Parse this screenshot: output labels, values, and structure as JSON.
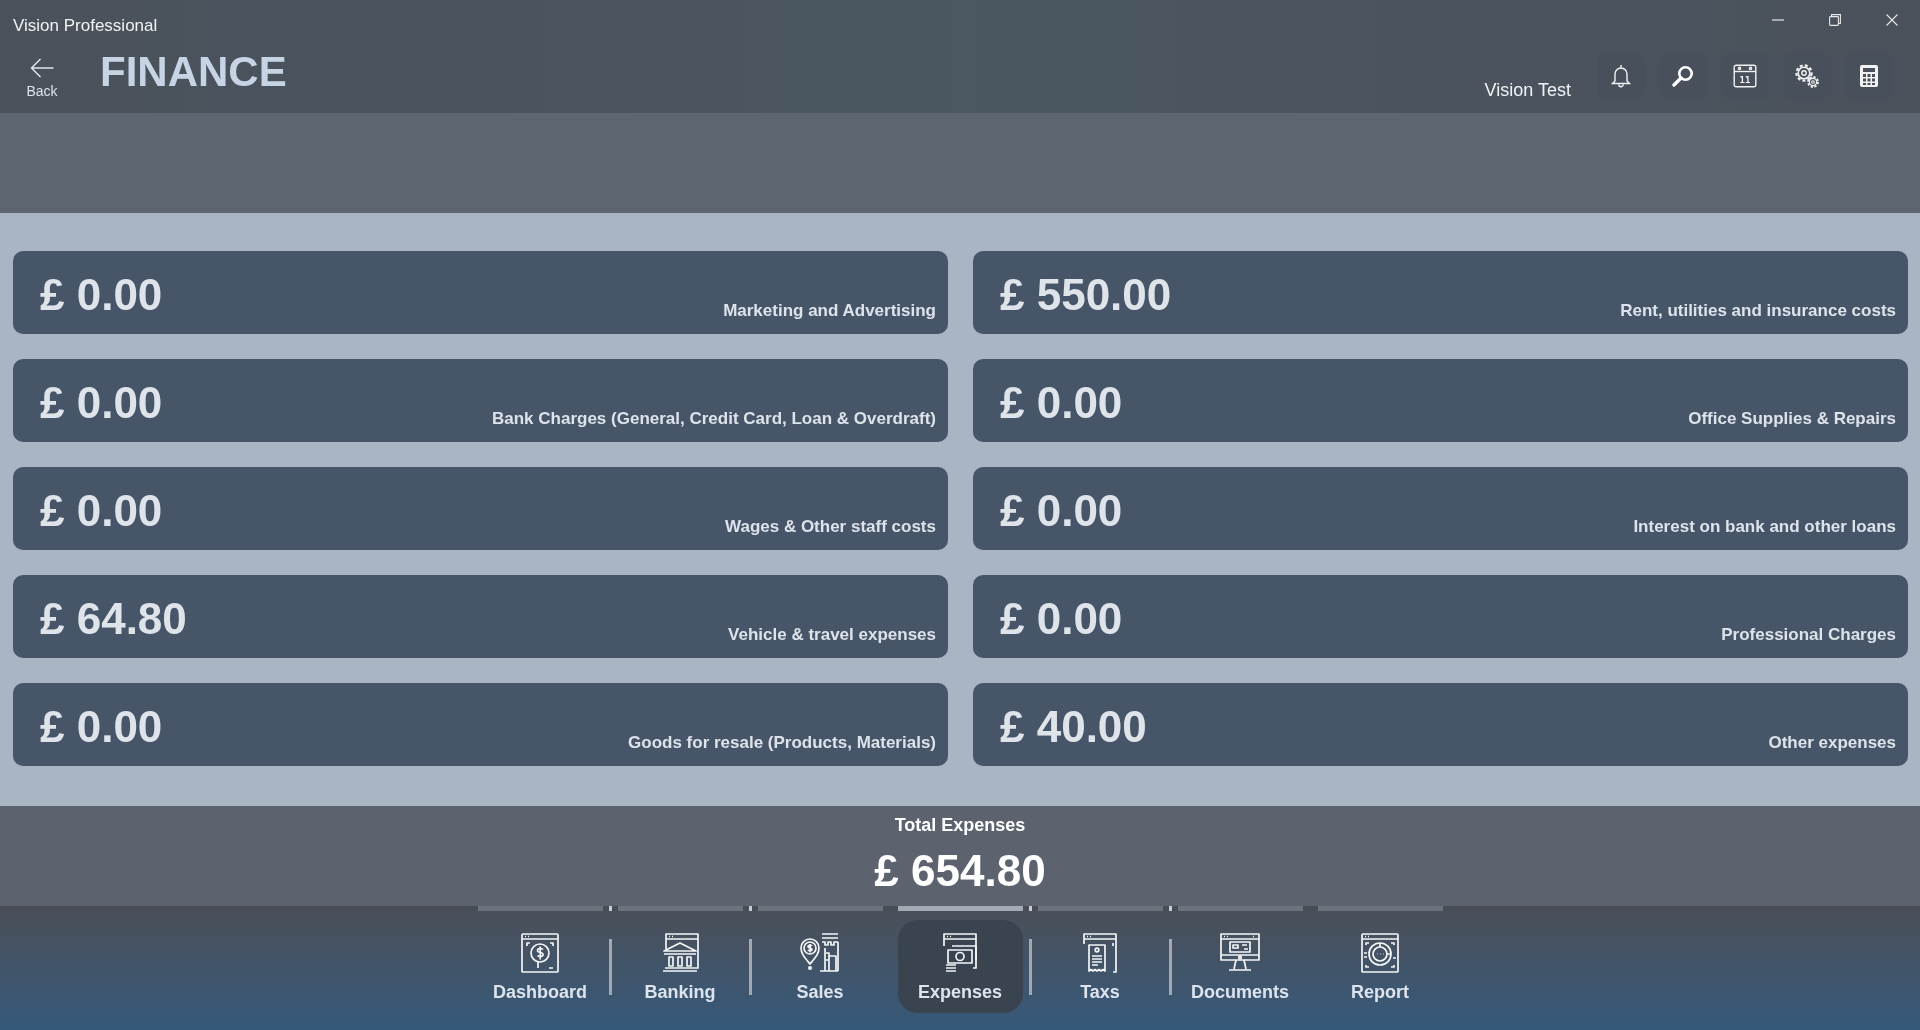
{
  "window": {
    "title": "Vision Professional"
  },
  "header": {
    "back_label": "Back",
    "title": "FINANCE",
    "user_name": "Vision Test",
    "calendar_day": "11"
  },
  "expense_cards": [
    {
      "amount": "£ 0.00",
      "label": "Marketing and Advertising"
    },
    {
      "amount": "£ 550.00",
      "label": "Rent, utilities and insurance costs"
    },
    {
      "amount": "£ 0.00",
      "label": "Bank Charges (General, Credit Card, Loan & Overdraft)"
    },
    {
      "amount": "£ 0.00",
      "label": "Office Supplies & Repairs"
    },
    {
      "amount": "£ 0.00",
      "label": "Wages & Other staff costs"
    },
    {
      "amount": "£ 0.00",
      "label": "Interest on bank and other loans"
    },
    {
      "amount": "£ 64.80",
      "label": "Vehicle & travel expenses"
    },
    {
      "amount": "£ 0.00",
      "label": "Professional Charges"
    },
    {
      "amount": "£ 0.00",
      "label": "Goods for resale (Products, Materials)"
    },
    {
      "amount": "£ 40.00",
      "label": "Other expenses"
    }
  ],
  "total": {
    "label": "Total Expenses",
    "amount": "£ 654.80"
  },
  "nav_tabs": [
    {
      "label": "Dashboard",
      "selected": false,
      "separator_after": true
    },
    {
      "label": "Banking",
      "selected": false,
      "separator_after": true
    },
    {
      "label": "Sales",
      "selected": false,
      "separator_after": false
    },
    {
      "label": "Expenses",
      "selected": true,
      "separator_after": true
    },
    {
      "label": "Taxs",
      "selected": false,
      "separator_after": true
    },
    {
      "label": "Documents",
      "selected": false,
      "separator_after": false
    },
    {
      "label": "Report",
      "selected": false,
      "separator_after": false
    }
  ]
}
